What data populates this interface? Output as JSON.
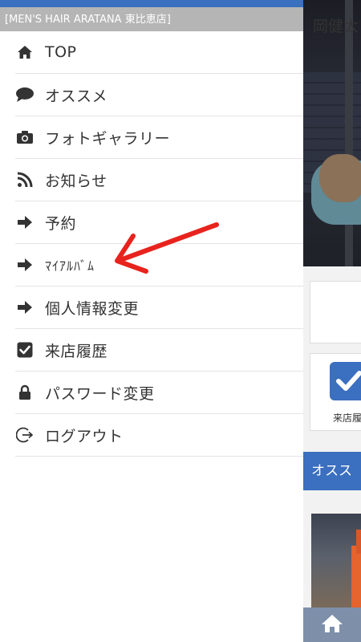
{
  "drawer": {
    "header_title": "[MEN'S HAIR ARATANA 東比恵店]",
    "items": [
      {
        "label": "TOP",
        "icon": "home-icon"
      },
      {
        "label": "オススメ",
        "icon": "speech-bubble-icon"
      },
      {
        "label": "フォトギャラリー",
        "icon": "camera-icon"
      },
      {
        "label": "お知らせ",
        "icon": "rss-icon"
      },
      {
        "label": "予約",
        "icon": "arrow-right-icon"
      },
      {
        "label": "ﾏｲｱﾙﾊﾞﾑ",
        "icon": "arrow-right-icon"
      },
      {
        "label": "個人情報変更",
        "icon": "arrow-right-icon"
      },
      {
        "label": "来店履歴",
        "icon": "checkbox-icon"
      },
      {
        "label": "パスワード変更",
        "icon": "lock-icon"
      },
      {
        "label": "ログアウト",
        "icon": "logout-icon"
      }
    ]
  },
  "background_page": {
    "name_text": "岡健太",
    "visit_label": "来店履",
    "osusume_label": "オスス"
  },
  "colors": {
    "accent": "#3b6fbf",
    "header_bg": "#b5b5b5",
    "annotation_red": "#e8231d"
  }
}
